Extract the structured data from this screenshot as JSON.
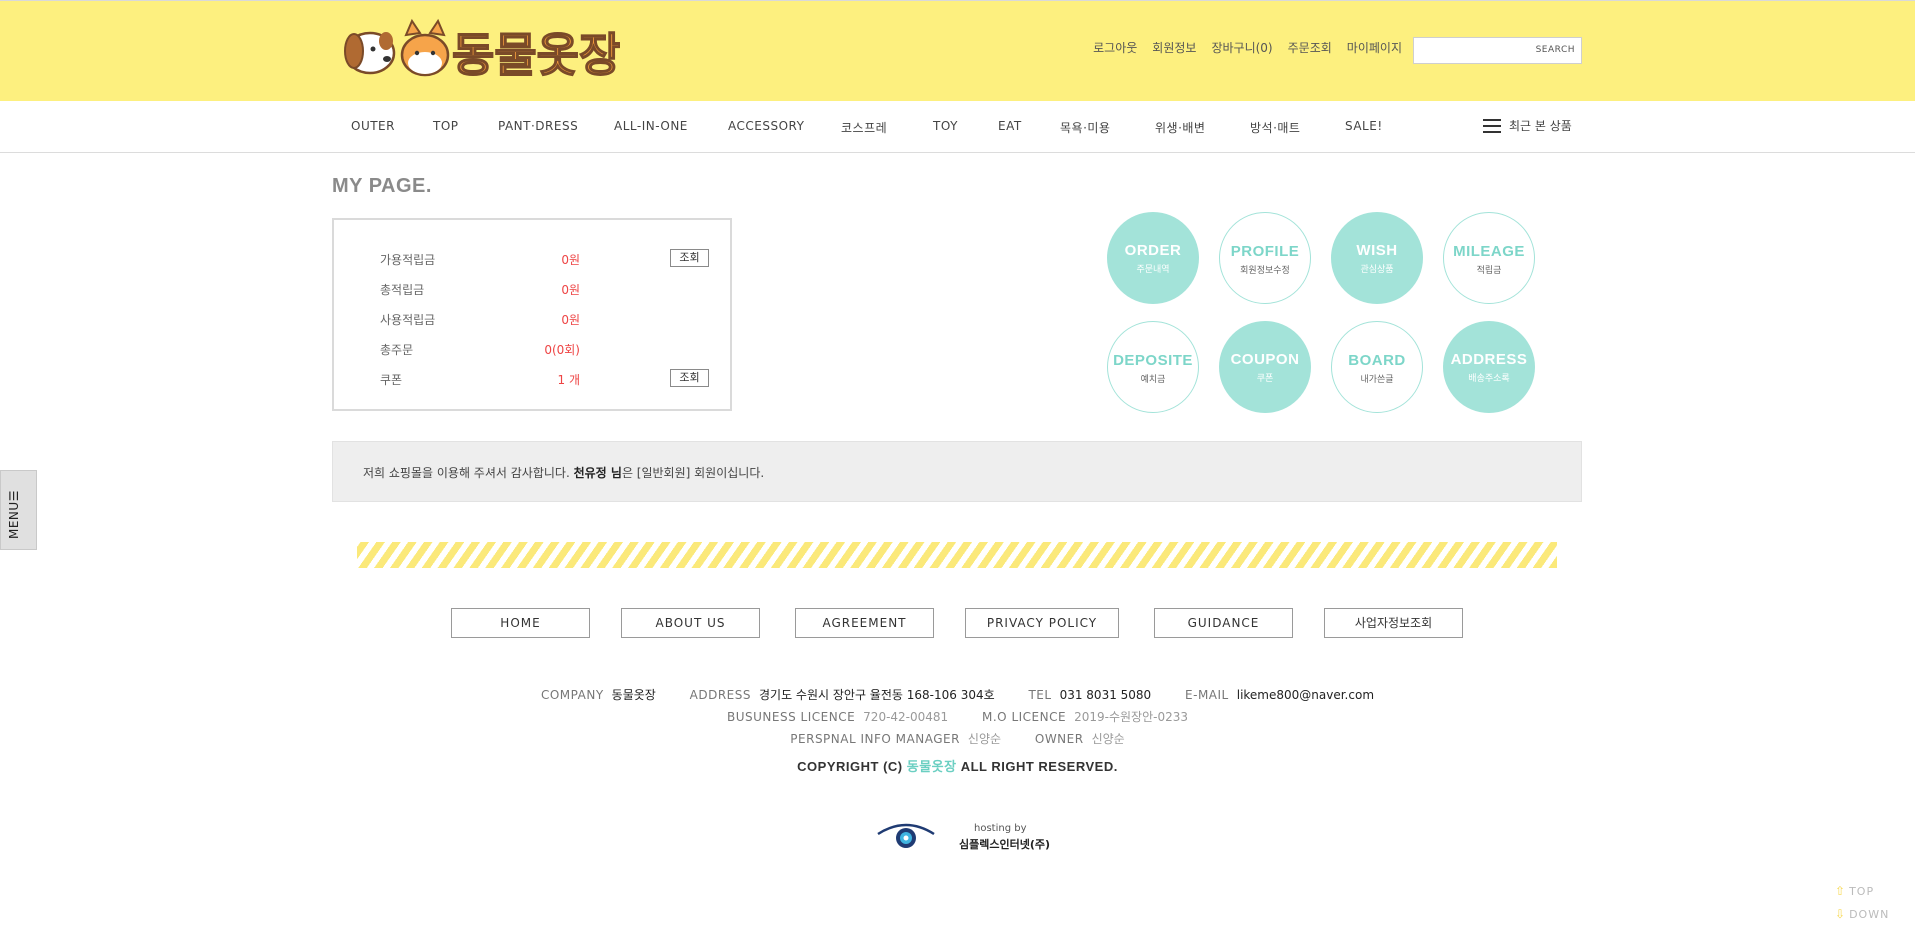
{
  "header": {
    "logo_text": "동물옷장",
    "top_links": [
      "로그아웃",
      "회원정보",
      "장바구니(0)",
      "주문조회",
      "마이페이지"
    ],
    "search": {
      "value": "",
      "button_label": "SEARCH"
    }
  },
  "nav": {
    "items": [
      "OUTER",
      "TOP",
      "PANT·DRESS",
      "ALL-IN-ONE",
      "ACCESSORY",
      "코스프레",
      "TOY",
      "EAT",
      "목욕·미용",
      "위생·배변",
      "방석·매트",
      "SALE!"
    ],
    "recent_label": "최근 본 상품"
  },
  "side_menu": {
    "label": "MENU☰"
  },
  "mypage": {
    "title": "MY PAGE.",
    "rows": [
      {
        "label": "가용적립금",
        "value": "0원",
        "button": "조회"
      },
      {
        "label": "총적립금",
        "value": "0원"
      },
      {
        "label": "사용적립금",
        "value": "0원"
      },
      {
        "label": "총주문",
        "value": "0(0회)"
      },
      {
        "label": "쿠폰",
        "value": "1 개",
        "button": "조회"
      }
    ],
    "circles": [
      {
        "title": "ORDER",
        "sub": "주문내역",
        "style": "filled"
      },
      {
        "title": "PROFILE",
        "sub": "회원정보수정",
        "style": "outline"
      },
      {
        "title": "WISH",
        "sub": "관심상품",
        "style": "filled"
      },
      {
        "title": "MILEAGE",
        "sub": "적립금",
        "style": "outline"
      },
      {
        "title": "DEPOSITE",
        "sub": "예치금",
        "style": "outline"
      },
      {
        "title": "COUPON",
        "sub": "쿠폰",
        "style": "filled"
      },
      {
        "title": "BOARD",
        "sub": "내가쓴글",
        "style": "outline"
      },
      {
        "title": "ADDRESS",
        "sub": "배송주소록",
        "style": "filled"
      }
    ],
    "welcome": {
      "prefix": "저희 쇼핑몰을 이용해 주셔서 감사합니다.",
      "user": "천유정 님",
      "suffix": "은 [일반회원] 회원이십니다."
    }
  },
  "footer": {
    "buttons": [
      "HOME",
      "ABOUT US",
      "AGREEMENT",
      "PRIVACY POLICY",
      "GUIDANCE",
      "사업자정보조회"
    ],
    "company_label": "COMPANY",
    "company": "동물옷장",
    "address_label": "ADDRESS",
    "address": "경기도 수원시 장안구 율전동 168-106 304호",
    "tel_label": "TEL",
    "tel": "031 8031 5080",
    "email_label": "E-MAIL",
    "email": "likeme800@naver.com",
    "business_label": "BUSUNESS LICENCE",
    "business": "720-42-00481",
    "mo_label": "M.O LICENCE",
    "mo": "2019-수원장안-0233",
    "manager_label": "PERSPNAL INFO MANAGER",
    "manager": "신양순",
    "owner_label": "OWNER",
    "owner": "신양순",
    "copyright_prefix": "COPYRIGHT (C)",
    "copyright_brand": "동물옷장",
    "copyright_suffix": "ALL RIGHT RESERVED.",
    "hosting_by": "hosting by",
    "hosting_company": "심플렉스인터넷(주)"
  },
  "scroll": {
    "top_label": "TOP",
    "down_label": "DOWN"
  },
  "colors": {
    "header_bg": "#fdf07f",
    "accent_mint": "#a3e3d9",
    "price_red": "#ee4444"
  }
}
